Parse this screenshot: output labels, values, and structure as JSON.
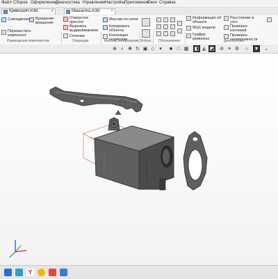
{
  "menu": [
    "Файл",
    "Сборка",
    "Оформление",
    "Диагностика",
    "Управление",
    "Настройка",
    "Приложения",
    "Окно",
    "Справка"
  ],
  "tabs": [
    {
      "label": "Кривошип.m3d"
    },
    {
      "label": "Мышалка.m3d"
    }
  ],
  "ribbon": {
    "components": {
      "items": [
        "Совпадение",
        "Вращение-вращение",
        "Переместить компонент"
      ],
      "group_label": "Размещение компонентов"
    },
    "operations": {
      "items": [
        "Отверстие простое",
        "Вырезать выдавливанием",
        "Сечение"
      ],
      "group_label": "Операции"
    },
    "array": {
      "items": [
        "Массив по сетке",
        "Копировать объекты",
        "Коллекция геометрии"
      ],
      "group_label": "Массив, копирование"
    },
    "aux": {
      "group_label": "Вспом..."
    },
    "markup": {
      "group_label": "Обозначения"
    },
    "diagnostics": {
      "items": [
        "Информация об объекте",
        "МЦХ модели",
        "График кривизны",
        "Расстояние и угол",
        "Проверка коллизий",
        "Проверка непрерывности"
      ],
      "group_label": "Диагностика"
    }
  },
  "colors": {
    "part_fill": "#5f5f5f",
    "part_dark": "#3c3c3c",
    "part_light": "#8a8a8a",
    "sketch_red": "#e05a5a",
    "sketch_green": "#3caa3c",
    "sketch_yellow": "#d8d030",
    "axis_x": "#e02020",
    "axis_y": "#20a020",
    "axis_z": "#2040e0"
  },
  "taskbar": {
    "icons": [
      "edge-icon",
      "yandex-icon",
      "cortana-icon",
      "zen-icon",
      "kompas-icon",
      "app-icon"
    ],
    "yandex_letter": "Y"
  }
}
